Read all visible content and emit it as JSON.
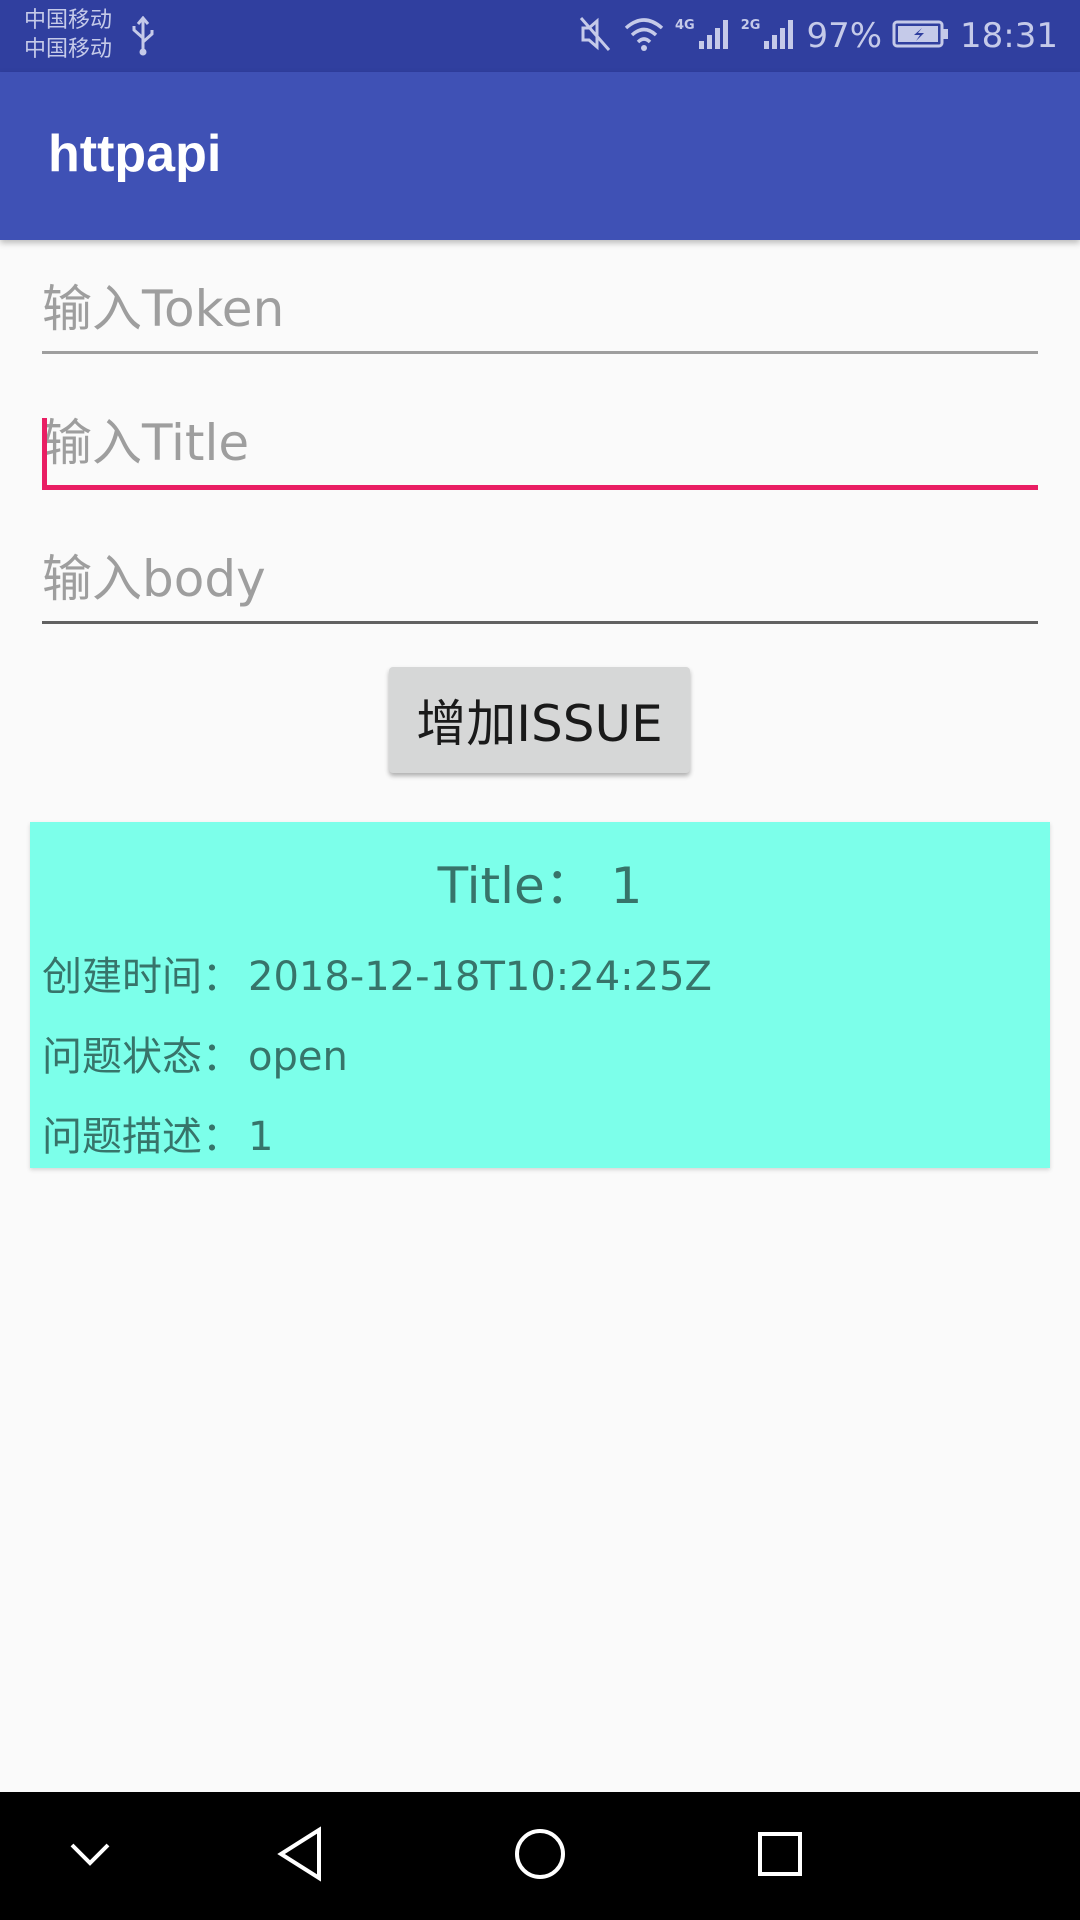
{
  "status_bar": {
    "carrier_1": "中国移动",
    "carrier_2": "中国移动",
    "net_1": "4G",
    "net_2": "2G",
    "battery": "97%",
    "time": "18:31"
  },
  "app": {
    "title": "httpapi"
  },
  "form": {
    "token_placeholder": "输入Token",
    "title_placeholder": "输入Title",
    "body_placeholder": "输入body",
    "token_value": "",
    "title_value": "",
    "body_value": "",
    "submit_label": "增加ISSUE"
  },
  "issue": {
    "title_label": "Title：",
    "title_value": "1",
    "created_label": "创建时间：",
    "created_value": "2018-12-18T10:24:25Z",
    "state_label": "问题状态：",
    "state_value": "open",
    "body_label": "问题描述：",
    "body_value": "1"
  },
  "colors": {
    "status_bar": "#303f9f",
    "app_bar": "#3f51b5",
    "accent": "#e91e63",
    "card": "#7cffea"
  }
}
